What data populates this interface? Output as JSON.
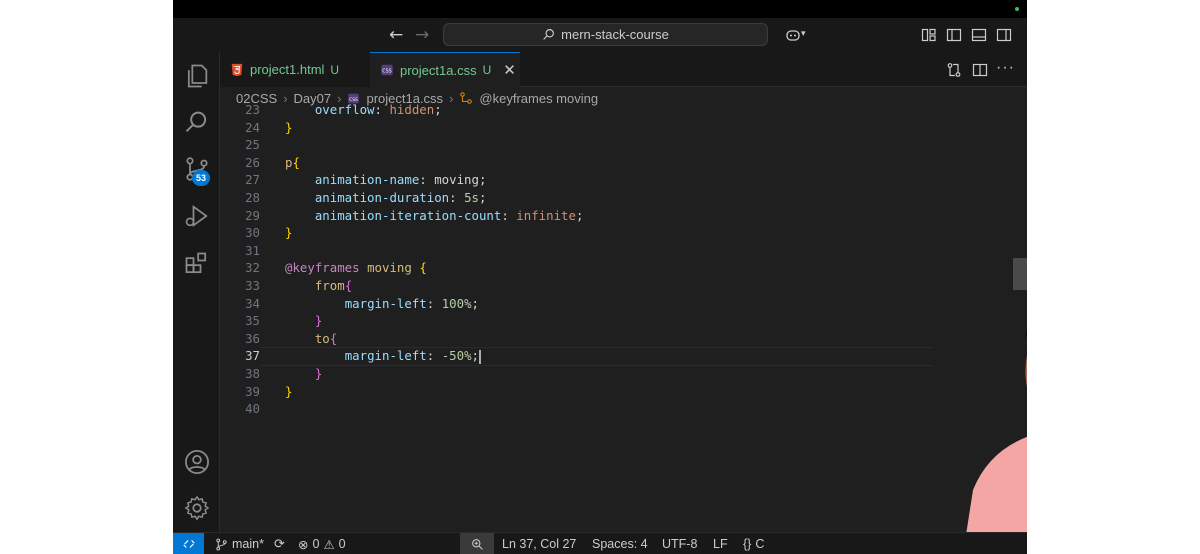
{
  "titlebar": {
    "back_icon": "arrow-left-icon",
    "forward_icon": "arrow-right-icon",
    "search_text": "mern-stack-course"
  },
  "activity": {
    "source_control_badge": "53"
  },
  "tabs": [
    {
      "label": "project1.html",
      "status": "U",
      "icon": "html5-icon",
      "active": false
    },
    {
      "label": "project1a.css",
      "status": "U",
      "icon": "css-icon",
      "active": true
    }
  ],
  "breadcrumb": {
    "items": [
      "02CSS",
      "Day07",
      "project1a.css",
      "@keyframes moving"
    ]
  },
  "code": {
    "active_line": "37",
    "lines": [
      {
        "n": "23",
        "text": "    overflow: hidden;"
      },
      {
        "n": "24",
        "text": "}"
      },
      {
        "n": "25",
        "text": ""
      },
      {
        "n": "26",
        "text": "p{"
      },
      {
        "n": "27",
        "text": "    animation-name: moving;"
      },
      {
        "n": "28",
        "text": "    animation-duration: 5s;"
      },
      {
        "n": "29",
        "text": "    animation-iteration-count: infinite;"
      },
      {
        "n": "30",
        "text": "}"
      },
      {
        "n": "31",
        "text": ""
      },
      {
        "n": "32",
        "text": "@keyframes moving {"
      },
      {
        "n": "33",
        "text": "    from{"
      },
      {
        "n": "34",
        "text": "        margin-left: 100%;"
      },
      {
        "n": "35",
        "text": "    }"
      },
      {
        "n": "36",
        "text": "    to{"
      },
      {
        "n": "37",
        "text": "        margin-left: -50%;"
      },
      {
        "n": "38",
        "text": "    }"
      },
      {
        "n": "39",
        "text": "}"
      },
      {
        "n": "40",
        "text": ""
      }
    ]
  },
  "status": {
    "branch": "main*",
    "errors": "0",
    "warnings": "0",
    "position": "Ln 37, Col 27",
    "spaces": "Spaces: 4",
    "encoding": "UTF-8",
    "eol": "LF",
    "lang_partial": "C"
  },
  "colors": {
    "editor_bg": "#1f1f1f",
    "accent": "#0078d4",
    "untracked": "#73c991"
  }
}
